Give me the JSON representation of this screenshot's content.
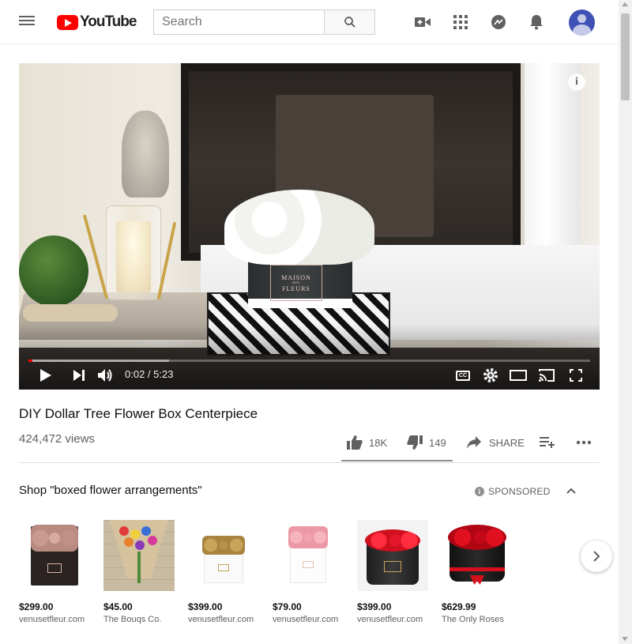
{
  "header": {
    "logo_text": "YouTube",
    "search_placeholder": "Search"
  },
  "player": {
    "time_display": "0:02 / 5:23",
    "progress_fraction": 0.006,
    "buffered_fraction": 0.25,
    "box_label_line1": "MAISON",
    "box_label_line2": "des",
    "box_label_line3": "FLEURS",
    "info_icon": "i"
  },
  "video": {
    "title": "DIY Dollar Tree Flower Box Centerpiece",
    "views": "424,472 views",
    "likes": "18K",
    "dislikes": "149",
    "share_label": "SHARE"
  },
  "shelf": {
    "title": "Shop \"boxed flower arrangements\"",
    "sponsored_label": "SPONSORED",
    "products": [
      {
        "price": "$299.00",
        "seller": "venusetfleur.com"
      },
      {
        "price": "$45.00",
        "seller": "The Bouqs Co."
      },
      {
        "price": "$399.00",
        "seller": "venusetfleur.com"
      },
      {
        "price": "$79.00",
        "seller": "venusetfleur.com"
      },
      {
        "price": "$399.00",
        "seller": "venusetfleur.com"
      },
      {
        "price": "$629.99",
        "seller": "The Only Roses"
      }
    ]
  },
  "colors": {
    "brand_red": "#ff0000",
    "progress_red": "#ff0000",
    "text_primary": "#0f0f0f",
    "text_secondary": "#606060"
  }
}
